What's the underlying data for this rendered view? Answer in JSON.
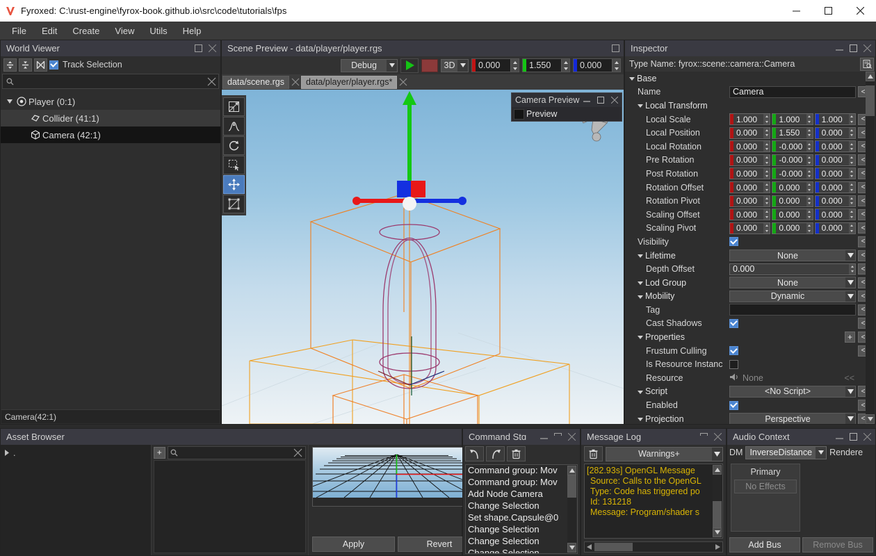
{
  "window": {
    "title": "Fyroxed: C:\\rust-engine\\fyrox-book.github.io\\src\\code\\tutorials\\fps",
    "minimize": "—",
    "maximize": "□",
    "close": "✕"
  },
  "menu": {
    "items": [
      "File",
      "Edit",
      "Create",
      "View",
      "Utils",
      "Help"
    ]
  },
  "world_viewer": {
    "title": "World Viewer",
    "toolbar": {
      "collapse_all": "collapse-all-icon",
      "expand_all": "expand-all-icon",
      "locate_selection": "locate-selection-icon",
      "track_selection_label": "Track Selection",
      "track_selection_checked": true
    },
    "search": {
      "value": "",
      "placeholder": ""
    },
    "tree": [
      {
        "label": "Player (0:1)",
        "icon": "pivot-icon",
        "depth": 0,
        "expanded": true,
        "state": "normal"
      },
      {
        "label": "Collider (41:1)",
        "icon": "collider-icon",
        "depth": 1,
        "expanded": false,
        "state": "hover"
      },
      {
        "label": "Camera (42:1)",
        "icon": "camera-icon",
        "depth": 1,
        "expanded": false,
        "state": "selected"
      }
    ],
    "status": "Camera(42:1)"
  },
  "scene_preview": {
    "title": "Scene Preview - data/player/player.rgs",
    "toolbar": {
      "build_profile": "Debug",
      "play_label": "play-icon",
      "stop_label": "stop-icon",
      "mode": "3D",
      "snap_x": "0.000",
      "snap_y": "1.550",
      "snap_z": "0.000"
    },
    "tabs": [
      {
        "label": "data/scene.rgs",
        "active": false
      },
      {
        "label": "data/player/player.rgs*",
        "active": true
      }
    ],
    "viewport_tools": [
      {
        "name": "scale-tool",
        "active": false
      },
      {
        "name": "terrain-tool",
        "active": false
      },
      {
        "name": "rotate-tool",
        "active": false
      },
      {
        "name": "select-tool",
        "active": false
      },
      {
        "name": "move-tool",
        "active": true
      },
      {
        "name": "navmesh-tool",
        "active": false
      }
    ],
    "camera_preview": {
      "title": "Camera Preview",
      "checkbox_label": "Preview",
      "checked": false
    }
  },
  "inspector": {
    "title": "Inspector",
    "type_name": "Type Name: fyrox::scene::camera::Camera",
    "revert_glyph": "<",
    "plus_glyph": "+",
    "rows": [
      {
        "kind": "group",
        "label": "Base",
        "indent": 0
      },
      {
        "kind": "text",
        "label": "Name",
        "indent": 1,
        "value": "Camera"
      },
      {
        "kind": "group",
        "label": "Local Transform",
        "indent": 1
      },
      {
        "kind": "vec3",
        "label": "Local Scale",
        "indent": 2,
        "values": [
          "1.000",
          "1.000",
          "1.000"
        ]
      },
      {
        "kind": "vec3",
        "label": "Local Position",
        "indent": 2,
        "values": [
          "0.000",
          "1.550",
          "0.000"
        ]
      },
      {
        "kind": "vec3",
        "label": "Local Rotation",
        "indent": 2,
        "values": [
          "0.000",
          "-0.000",
          "0.000"
        ]
      },
      {
        "kind": "vec3",
        "label": "Pre Rotation",
        "indent": 2,
        "values": [
          "0.000",
          "-0.000",
          "0.000"
        ]
      },
      {
        "kind": "vec3",
        "label": "Post Rotation",
        "indent": 2,
        "values": [
          "0.000",
          "-0.000",
          "0.000"
        ]
      },
      {
        "kind": "vec3",
        "label": "Rotation Offset",
        "indent": 2,
        "values": [
          "0.000",
          "0.000",
          "0.000"
        ]
      },
      {
        "kind": "vec3",
        "label": "Rotation Pivot",
        "indent": 2,
        "values": [
          "0.000",
          "0.000",
          "0.000"
        ]
      },
      {
        "kind": "vec3",
        "label": "Scaling Offset",
        "indent": 2,
        "values": [
          "0.000",
          "0.000",
          "0.000"
        ]
      },
      {
        "kind": "vec3",
        "label": "Scaling Pivot",
        "indent": 2,
        "values": [
          "0.000",
          "0.000",
          "0.000"
        ]
      },
      {
        "kind": "check",
        "label": "Visibility",
        "indent": 1,
        "checked": true
      },
      {
        "kind": "group-drop",
        "label": "Lifetime",
        "indent": 1,
        "value": "None"
      },
      {
        "kind": "num",
        "label": "Depth Offset",
        "indent": 2,
        "value": "0.000"
      },
      {
        "kind": "group-drop",
        "label": "Lod Group",
        "indent": 1,
        "value": "None"
      },
      {
        "kind": "group-drop",
        "label": "Mobility",
        "indent": 1,
        "value": "Dynamic"
      },
      {
        "kind": "text",
        "label": "Tag",
        "indent": 2,
        "value": ""
      },
      {
        "kind": "check",
        "label": "Cast Shadows",
        "indent": 2,
        "checked": true
      },
      {
        "kind": "group-plus",
        "label": "Properties",
        "indent": 1
      },
      {
        "kind": "check",
        "label": "Frustum Culling",
        "indent": 2,
        "checked": true
      },
      {
        "kind": "check-noreset",
        "label": "Is Resource Instanc",
        "indent": 2,
        "checked": false
      },
      {
        "kind": "resource",
        "label": "Resource",
        "indent": 2,
        "value": "None",
        "button": "<<"
      },
      {
        "kind": "group-drop-noarrow",
        "label": "Script",
        "indent": 1,
        "value": "<No Script>"
      },
      {
        "kind": "check",
        "label": "Enabled",
        "indent": 2,
        "checked": true
      },
      {
        "kind": "group-drop",
        "label": "Projection",
        "indent": 1,
        "value": "Perspective"
      }
    ]
  },
  "asset_browser": {
    "title": "Asset Browser",
    "tree_root": ".",
    "add_button": "+",
    "search": {
      "value": "",
      "placeholder": ""
    },
    "preview": {
      "fullscreen_icon": "fullscreen-icon"
    },
    "apply_label": "Apply",
    "revert_label": "Revert"
  },
  "command_stack": {
    "title": "Command Stɑ",
    "undo_icon": "undo-icon",
    "redo_icon": "redo-icon",
    "clear_icon": "trash-icon",
    "items": [
      "Command group: Mov",
      "Command group: Mov",
      "Add Node Camera",
      "Change Selection",
      "Set shape.Capsule@0",
      "Change Selection",
      "Change Selection",
      "Change Selection"
    ]
  },
  "message_log": {
    "title": "Message Log",
    "clear_icon": "trash-icon",
    "filter": "Warnings+",
    "lines": [
      "[282.93s] OpenGL Message",
      "Source: Calls to the OpenGL",
      "Type: Code has triggered po",
      "Id: 131218",
      "Message: Program/shader s"
    ]
  },
  "audio_context": {
    "title": "Audio Context",
    "dm_label": "DM",
    "distance_model": "InverseDistance",
    "renderer_label": "Rendere",
    "bus_name": "Primary",
    "no_effects": "No Effects",
    "add_bus": "Add Bus",
    "remove_bus": "Remove Bus"
  },
  "colors": {
    "accent": "#4a84d0",
    "panel_header": "#3a3a42",
    "panel_bg": "#2e2e2e",
    "axis_x": "#d02020",
    "axis_y": "#18c018",
    "axis_z": "#1030d8",
    "warning_text": "#d9b404",
    "selection_orange": "#f08c28"
  }
}
